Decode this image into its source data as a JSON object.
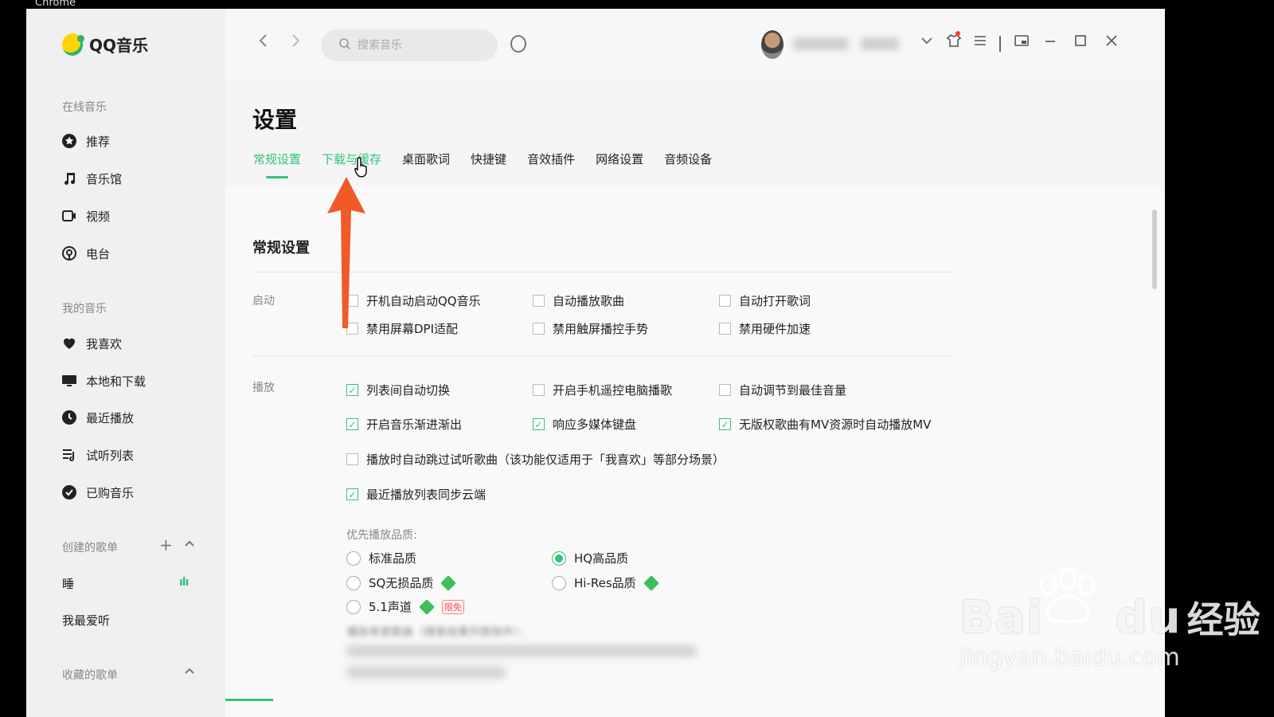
{
  "browser": {
    "label": "Chrome"
  },
  "app": {
    "name": "QQ音乐"
  },
  "sidebar": {
    "online_title": "在线音乐",
    "online_items": [
      {
        "label": "推荐",
        "icon": "star-icon"
      },
      {
        "label": "音乐馆",
        "icon": "music-note-icon"
      },
      {
        "label": "视频",
        "icon": "video-icon"
      },
      {
        "label": "电台",
        "icon": "radio-icon"
      }
    ],
    "mine_title": "我的音乐",
    "mine_items": [
      {
        "label": "我喜欢",
        "icon": "heart-icon"
      },
      {
        "label": "本地和下载",
        "icon": "monitor-icon"
      },
      {
        "label": "最近播放",
        "icon": "clock-icon"
      },
      {
        "label": "试听列表",
        "icon": "playlist-icon"
      },
      {
        "label": "已购音乐",
        "icon": "check-circle-icon"
      }
    ],
    "created_title": "创建的歌单",
    "created_items": [
      "睡",
      "我最爱听"
    ],
    "collected_title": "收藏的歌单"
  },
  "topbar": {
    "search_placeholder": "搜索音乐"
  },
  "settings": {
    "title": "设置",
    "tabs": [
      "常规设置",
      "下载与缓存",
      "桌面歌词",
      "快捷键",
      "音效插件",
      "网络设置",
      "音频设备"
    ],
    "active_tab": "常规设置",
    "section_title": "常规设置",
    "startup": {
      "label": "启动",
      "options": [
        {
          "label": "开机自动启动QQ音乐",
          "checked": false
        },
        {
          "label": "自动播放歌曲",
          "checked": false
        },
        {
          "label": "自动打开歌词",
          "checked": false
        },
        {
          "label": "禁用屏幕DPI适配",
          "checked": false
        },
        {
          "label": "禁用触屏播控手势",
          "checked": false
        },
        {
          "label": "禁用硬件加速",
          "checked": false
        }
      ]
    },
    "playback": {
      "label": "播放",
      "options": [
        {
          "label": "列表间自动切换",
          "checked": true
        },
        {
          "label": "开启手机遥控电脑播歌",
          "checked": false
        },
        {
          "label": "自动调节到最佳音量",
          "checked": false
        },
        {
          "label": "开启音乐渐进渐出",
          "checked": true
        },
        {
          "label": "响应多媒体键盘",
          "checked": true
        },
        {
          "label": "无版权歌曲有MV资源时自动播放MV",
          "checked": true
        },
        {
          "label": "播放时自动跳过试听歌曲（该功能仅适用于「我喜欢」等部分场景）",
          "checked": false
        },
        {
          "label": "最近播放列表同步云端",
          "checked": true
        }
      ],
      "quality_label": "优先播放品质:",
      "quality_options": [
        {
          "label": "标准品质",
          "selected": false
        },
        {
          "label": "HQ高品质",
          "selected": true
        },
        {
          "label": "SQ无损品质",
          "selected": false
        },
        {
          "label": "Hi-Res品质",
          "selected": false
        },
        {
          "label": "5.1声道",
          "selected": false,
          "badge": "限免"
        }
      ],
      "single_song_label": "播放单首歌曲（搜索结果列表除外）："
    }
  },
  "watermark": {
    "brand": "Bai",
    "brand2": "du",
    "cn": "经验",
    "url": "jingyan.baidu.com"
  },
  "colors": {
    "accent": "#31c27c",
    "arrow": "#f05a28"
  }
}
